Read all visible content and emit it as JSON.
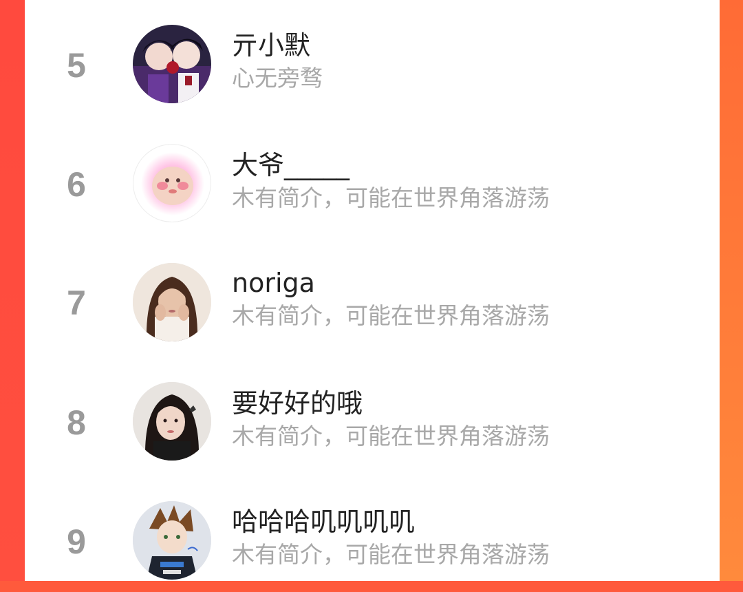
{
  "ranking": {
    "items": [
      {
        "rank": "5",
        "name": "亓小默",
        "bio": "心无旁骛",
        "avatar_icon": "anime-couple-avatar"
      },
      {
        "rank": "6",
        "name": "大爷_____",
        "bio": "木有简介，可能在世界角落游荡",
        "avatar_icon": "pink-blob-avatar"
      },
      {
        "rank": "7",
        "name": "noriga",
        "bio": "木有简介，可能在世界角落游荡",
        "avatar_icon": "woman-portrait-avatar"
      },
      {
        "rank": "8",
        "name": "要好好的哦",
        "bio": "木有简介，可能在世界角落游荡",
        "avatar_icon": "girl-portrait-avatar"
      },
      {
        "rank": "9",
        "name": "哈哈哈叽叽叽叽",
        "bio": "木有简介，可能在世界角落游荡",
        "avatar_icon": "anime-racer-avatar"
      }
    ]
  },
  "colors": {
    "accent_left": "#ff4a3e",
    "accent_right": "#ff7a3c",
    "rank_gray": "#9a9a9a",
    "name_text": "#222222",
    "bio_text": "#a8a8a8"
  }
}
